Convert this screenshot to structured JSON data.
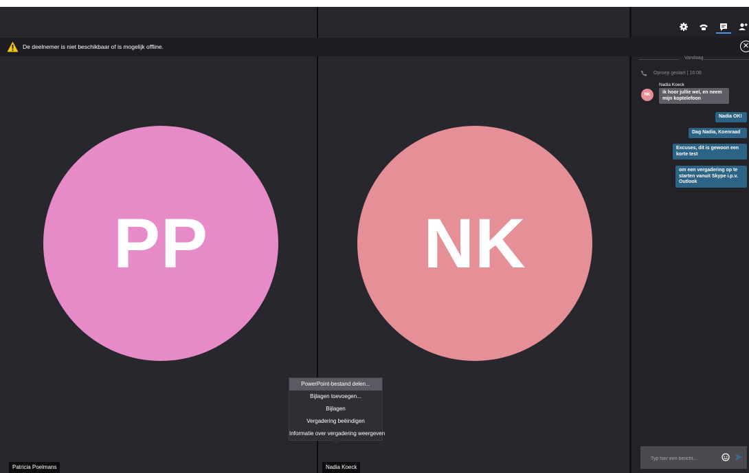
{
  "banner": {
    "message": "De deelnemer is niet beschikbaar of is mogelijk offline.",
    "icon": "warning-icon",
    "close_icon": "close-icon",
    "warning_color": "#f5c518"
  },
  "participants": [
    {
      "initials": "PP",
      "name": "Patricia Poelmans",
      "color": "#e68bc8"
    },
    {
      "initials": "NK",
      "name": "Nadia Koeck",
      "color": "#e58f97"
    }
  ],
  "context_menu": {
    "items": [
      "PowerPoint-bestand delen...",
      "Bijlagen toevoegen...",
      "Bijlagen",
      "Vergadering beëindigen",
      "Informatie over vergadering weergeven"
    ],
    "highlighted_index": 0
  },
  "toolbar": {
    "icons": [
      "gear-icon",
      "phone-icon",
      "chat-icon",
      "participants-icon"
    ],
    "active_tab": "chat-icon",
    "accent": "#3c9be6"
  },
  "chat": {
    "date_separator": "Vandaag",
    "call_status": "Oproep gestart | 16:08",
    "sender_name": "Nadia Koeck",
    "sender_initials": "NK",
    "messages": [
      {
        "direction": "in",
        "text": "ik hoor jullie wel, en neem mijn koptelefoon"
      },
      {
        "direction": "out",
        "text": "Nadia OK!"
      },
      {
        "direction": "out",
        "text": "Dag Nadia, Koenraad"
      },
      {
        "direction": "out",
        "text": "Excuses, dit is gewoon een korte test"
      },
      {
        "direction": "out",
        "text": "om een vergadering op te starten vanuit Skype i.p.v. Outlook"
      }
    ],
    "input_placeholder": "Typ hier een bericht...",
    "emoji_icon": "emoji-icon",
    "send_icon": "send-icon",
    "outgoing_color": "#2d6384"
  }
}
